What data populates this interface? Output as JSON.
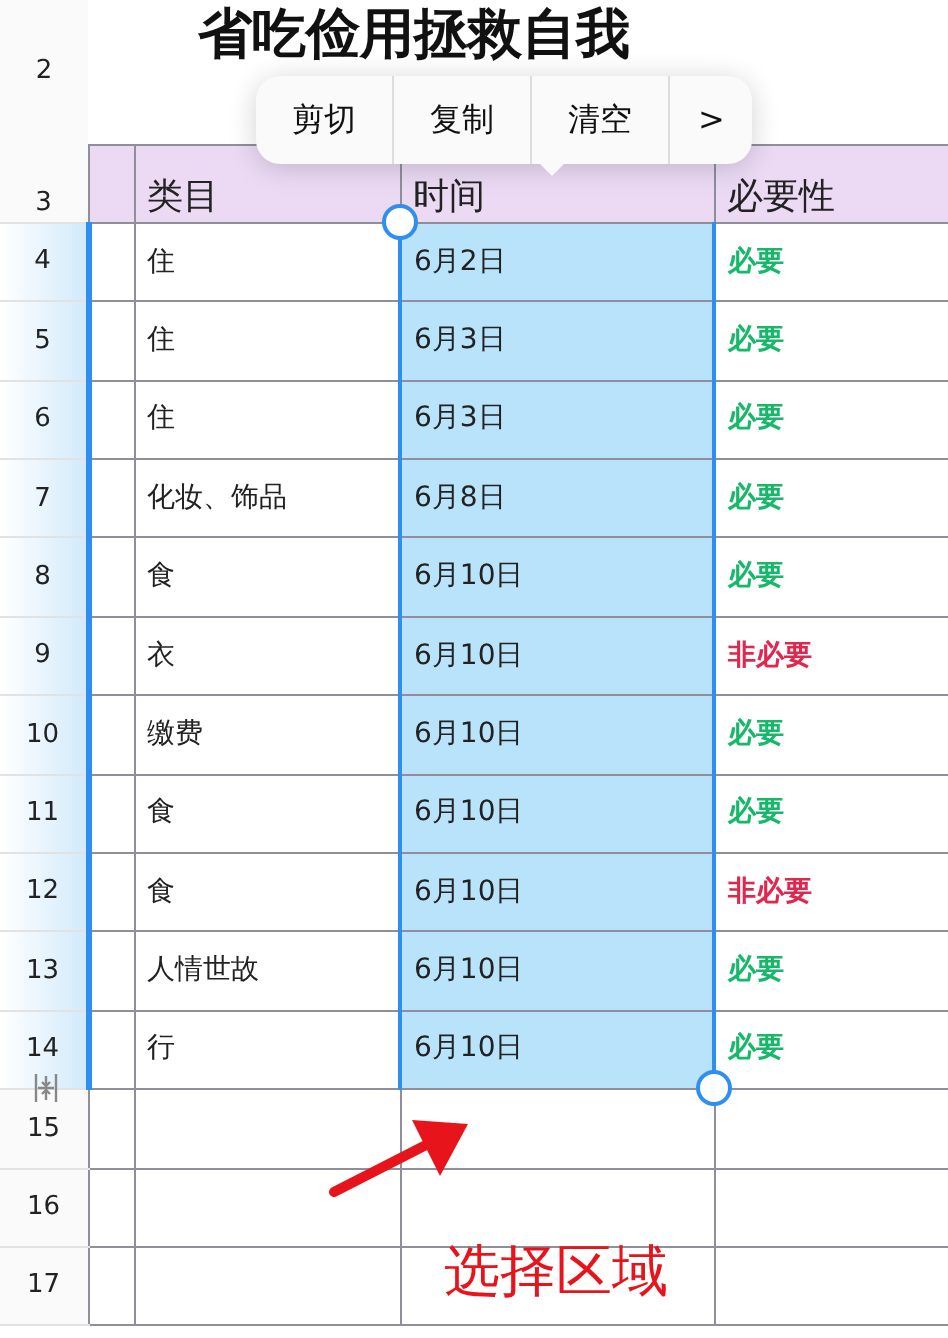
{
  "title": "省吃俭用拯救自我",
  "title_row_number": "2",
  "header": {
    "number": "3",
    "columns": [
      "类目",
      "时间",
      "必要性"
    ]
  },
  "rows": [
    {
      "number": "4",
      "category": "住",
      "date": "6月2日",
      "necessity": "必要",
      "color": "#17b86a",
      "selected": true
    },
    {
      "number": "5",
      "category": "住",
      "date": "6月3日",
      "necessity": "必要",
      "color": "#17b86a",
      "selected": true
    },
    {
      "number": "6",
      "category": "住",
      "date": "6月3日",
      "necessity": "必要",
      "color": "#17b86a",
      "selected": true
    },
    {
      "number": "7",
      "category": "化妆、饰品",
      "date": "6月8日",
      "necessity": "必要",
      "color": "#17b86a",
      "selected": true
    },
    {
      "number": "8",
      "category": "食",
      "date": "6月10日",
      "necessity": "必要",
      "color": "#17b86a",
      "selected": true
    },
    {
      "number": "9",
      "category": "衣",
      "date": "6月10日",
      "necessity": "非必要",
      "color": "#e0284f",
      "selected": true
    },
    {
      "number": "10",
      "category": "缴费",
      "date": "6月10日",
      "necessity": "必要",
      "color": "#17b86a",
      "selected": true
    },
    {
      "number": "11",
      "category": "食",
      "date": "6月10日",
      "necessity": "必要",
      "color": "#17b86a",
      "selected": true
    },
    {
      "number": "12",
      "category": "食",
      "date": "6月10日",
      "necessity": "非必要",
      "color": "#e0284f",
      "selected": true
    },
    {
      "number": "13",
      "category": "人情世故",
      "date": "6月10日",
      "necessity": "必要",
      "color": "#17b86a",
      "selected": true
    },
    {
      "number": "14",
      "category": "行",
      "date": "6月10日",
      "necessity": "必要",
      "color": "#17b86a",
      "selected": true
    },
    {
      "number": "15",
      "selected": false
    },
    {
      "number": "16",
      "selected": false
    },
    {
      "number": "17",
      "selected": false
    }
  ],
  "context_menu": {
    "items": [
      "剪切",
      "复制",
      "清空"
    ],
    "more": ">"
  },
  "annotation": {
    "text": "选择区域"
  }
}
